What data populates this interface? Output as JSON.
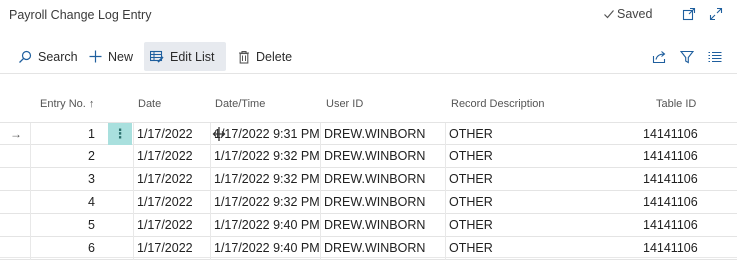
{
  "header": {
    "title": "Payroll Change Log Entry",
    "saved_label": "Saved"
  },
  "toolbar": {
    "search_label": "Search",
    "new_label": "New",
    "edit_list_label": "Edit List",
    "delete_label": "Delete"
  },
  "table": {
    "columns": {
      "entry_no": "Entry No. ↑",
      "date": "Date",
      "datetime": "Date/Time",
      "user_id": "User ID",
      "record_description": "Record Description",
      "table_id": "Table ID"
    },
    "rows": [
      {
        "entry_no": "1",
        "date": "1/17/2022",
        "datetime": "1/17/2022 9:31 PM",
        "user_id": "DREW.WINBORN",
        "record_description": "OTHER",
        "table_id": "14141106"
      },
      {
        "entry_no": "2",
        "date": "1/17/2022",
        "datetime": "1/17/2022 9:32 PM",
        "user_id": "DREW.WINBORN",
        "record_description": "OTHER",
        "table_id": "14141106"
      },
      {
        "entry_no": "3",
        "date": "1/17/2022",
        "datetime": "1/17/2022 9:32 PM",
        "user_id": "DREW.WINBORN",
        "record_description": "OTHER",
        "table_id": "14141106"
      },
      {
        "entry_no": "4",
        "date": "1/17/2022",
        "datetime": "1/17/2022 9:32 PM",
        "user_id": "DREW.WINBORN",
        "record_description": "OTHER",
        "table_id": "14141106"
      },
      {
        "entry_no": "5",
        "date": "1/17/2022",
        "datetime": "1/17/2022 9:40 PM",
        "user_id": "DREW.WINBORN",
        "record_description": "OTHER",
        "table_id": "14141106"
      },
      {
        "entry_no": "6",
        "date": "1/17/2022",
        "datetime": "1/17/2022 9:40 PM",
        "user_id": "DREW.WINBORN",
        "record_description": "OTHER",
        "table_id": "14141106"
      }
    ],
    "selected_row_marker": "→"
  },
  "icons": {
    "saved": "checkmark-icon",
    "open_new_window": "open-in-new-window-icon",
    "expand": "expand-icon",
    "search": "search-icon",
    "new": "plus-icon",
    "edit_list": "edit-list-icon",
    "delete": "trash-icon",
    "share": "share-icon",
    "filter": "filter-icon",
    "list_view": "list-view-icon",
    "row_menu": "kebab-menu-icon"
  },
  "colors": {
    "row_menu_bg": "#a9e0de",
    "active_action_bg": "#e7eaef"
  }
}
